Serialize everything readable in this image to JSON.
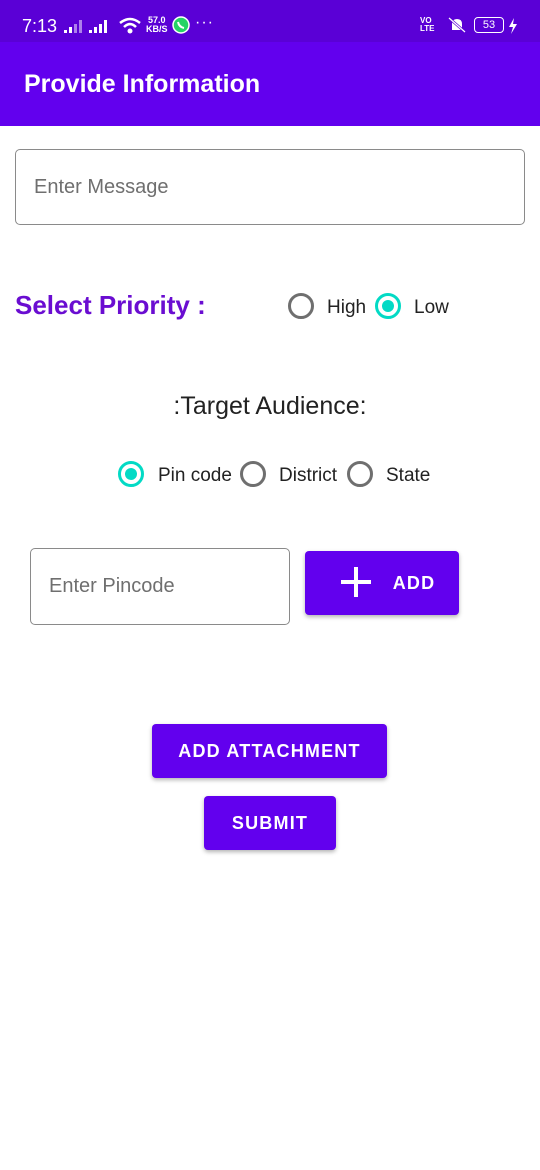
{
  "status_bar": {
    "time": "7:13",
    "net_speed_value": "57.0",
    "net_speed_unit": "KB/S",
    "more_indicator": "···",
    "network_label": "VO LTE",
    "battery": "53"
  },
  "app_bar": {
    "title": "Provide Information"
  },
  "message_field": {
    "placeholder": "Enter Message",
    "value": ""
  },
  "priority": {
    "label": "Select Priority :",
    "options": [
      {
        "label": "High",
        "selected": false
      },
      {
        "label": "Low",
        "selected": true
      }
    ]
  },
  "audience": {
    "title": ":Target Audience:",
    "options": [
      {
        "label": "Pin code",
        "selected": true
      },
      {
        "label": "District",
        "selected": false
      },
      {
        "label": "State",
        "selected": false
      }
    ]
  },
  "pincode_field": {
    "placeholder": "Enter Pincode",
    "value": ""
  },
  "add_button": {
    "label": "ADD",
    "icon": "plus-icon"
  },
  "attachment_button": {
    "label": "ADD ATTACHMENT"
  },
  "submit_button": {
    "label": "SUBMIT"
  },
  "colors": {
    "primary": "#6200ee",
    "status_bar": "#5a00d6",
    "accent": "#03dac5",
    "priority_label": "#6a0dd1"
  }
}
